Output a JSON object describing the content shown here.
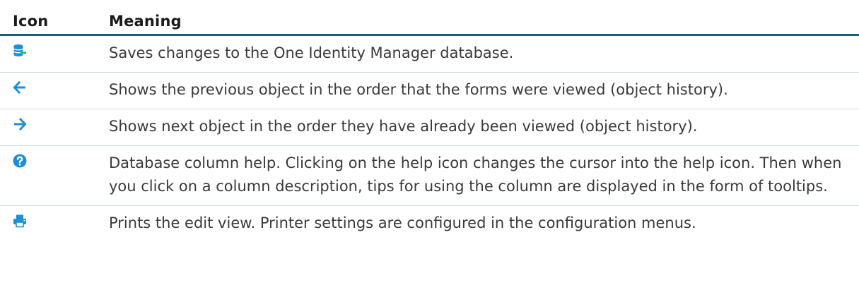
{
  "table": {
    "headers": {
      "icon": "Icon",
      "meaning": "Meaning"
    },
    "rows": [
      {
        "icon": "save-to-database-icon",
        "meaning": "Saves changes to the One Identity Manager database."
      },
      {
        "icon": "back-arrow-icon",
        "meaning": "Shows the previous object in the order that the forms were viewed (object history)."
      },
      {
        "icon": "forward-arrow-icon",
        "meaning": "Shows next object in the order they have already been viewed (object history)."
      },
      {
        "icon": "help-icon",
        "meaning": "Database column help. Clicking on the help icon changes the cursor into the help icon. Then when you click on a column description, tips for using the column are displayed in the form of tooltips."
      },
      {
        "icon": "printer-icon",
        "meaning": "Prints the edit view. Printer settings are configured in the configuration menus."
      }
    ]
  },
  "colors": {
    "header_rule": "#1d5f73",
    "icon_blue": "#1e8fd5",
    "icon_green": "#2bb673"
  }
}
